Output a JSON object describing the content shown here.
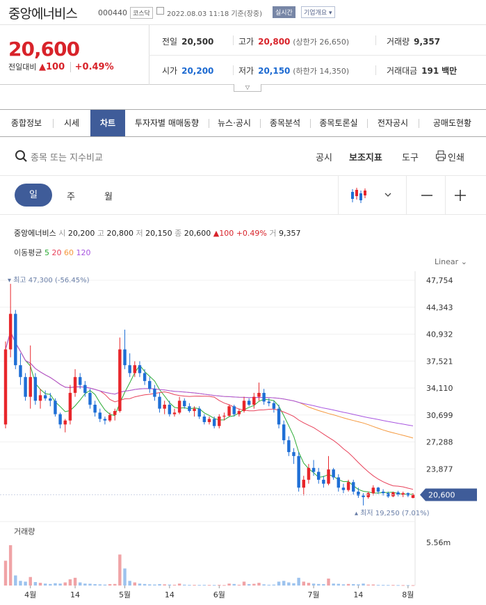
{
  "stock": {
    "name": "중앙에너비스",
    "code": "000440",
    "market": "코스닥",
    "datetime": "2022.08.03 11:18 기준(장중)",
    "realtime": "실시간",
    "company_btn": "기업개요 ▾"
  },
  "summary": {
    "price": "20,600",
    "change_label": "전일대비",
    "change_arrow": "▲",
    "change": "100",
    "change_pct": "+0.49%",
    "prev_label": "전일",
    "prev": "20,500",
    "high_label": "고가",
    "high": "20,800",
    "upper_limit": "(상한가 26,650)",
    "volume_label": "거래량",
    "volume": "9,357",
    "open_label": "시가",
    "open": "20,200",
    "low_label": "저가",
    "low": "20,150",
    "lower_limit": "(하한가 14,350)",
    "amount_label": "거래대금",
    "amount": "191",
    "amount_unit": "백만",
    "fold_icon": "chevron-down-icon"
  },
  "tabs": [
    "종합정보",
    "시세",
    "차트",
    "투자자별 매매동향",
    "뉴스·공시",
    "종목분석",
    "종목토론실",
    "전자공시",
    "공매도현황"
  ],
  "active_tab": "차트",
  "search": {
    "placeholder": "종목 또는 지수비교",
    "disclosure": "공시",
    "indicator": "보조지표",
    "tools": "도구",
    "print": "인쇄"
  },
  "periods": [
    "일",
    "주",
    "월"
  ],
  "active_period": "일",
  "ohlc": {
    "name": "중앙에너비스",
    "o_label": "시",
    "o": "20,200",
    "h_label": "고",
    "h": "20,800",
    "l_label": "저",
    "l": "20,150",
    "c_label": "종",
    "c": "20,600",
    "arrow": "▲",
    "chg": "100",
    "pct": "+0.49%",
    "v_label": "거",
    "v": "9,357"
  },
  "ma": {
    "label": "이동평균",
    "periods": [
      "5",
      "20",
      "60",
      "120"
    ],
    "colors": [
      "#2bab35",
      "#e8415a",
      "#f5983d",
      "#a855e0"
    ]
  },
  "scale": "Linear",
  "colors": {
    "up": "#e8262b",
    "down": "#1f6fd6",
    "accent": "#3f5c99",
    "max_label": "#6a7fa8"
  },
  "chart_data": {
    "type": "candlestick",
    "y_ticks": [
      "47,754",
      "44,343",
      "40,932",
      "37,521",
      "34,110",
      "30,699",
      "27,288",
      "23,877"
    ],
    "ylim": [
      20466,
      47754
    ],
    "x_ticks": [
      "4월",
      "14",
      "5월",
      "14",
      "6월",
      "7월",
      "14",
      "8월"
    ],
    "x_tick_index": [
      5,
      14,
      24,
      33,
      43,
      62,
      71,
      81
    ],
    "last_price_label": "20,600",
    "max_label": "최고 47,300 (-56.45%)",
    "max_index": 1,
    "max_value": 47300,
    "min_label": "최저 19,250 (7.01%)",
    "min_index": 72,
    "min_value": 19250,
    "volume_label": "거래량",
    "volume_tick": "5.56m",
    "volume_max": 5560000,
    "candles": [
      [
        29500,
        40000,
        29000,
        39000,
        3200000
      ],
      [
        39000,
        47300,
        38000,
        43500,
        5200000
      ],
      [
        43500,
        44000,
        36500,
        37000,
        1300000
      ],
      [
        37000,
        38500,
        34500,
        35500,
        600000
      ],
      [
        35500,
        36000,
        32500,
        33000,
        500000
      ],
      [
        33000,
        39500,
        31500,
        35500,
        1100000
      ],
      [
        35500,
        36000,
        32000,
        32500,
        450000
      ],
      [
        32500,
        34000,
        31500,
        33200,
        350000
      ],
      [
        33200,
        33800,
        32500,
        32800,
        250000
      ],
      [
        32800,
        33500,
        31800,
        32500,
        200000
      ],
      [
        32500,
        32800,
        30500,
        30800,
        300000
      ],
      [
        30800,
        31000,
        29000,
        29500,
        250000
      ],
      [
        29500,
        30200,
        28500,
        30000,
        400000
      ],
      [
        30000,
        34500,
        29500,
        33500,
        800000
      ],
      [
        33500,
        36500,
        33000,
        35500,
        1000000
      ],
      [
        35500,
        36000,
        34000,
        34500,
        400000
      ],
      [
        34500,
        35000,
        33000,
        33500,
        250000
      ],
      [
        33500,
        34000,
        31500,
        32000,
        230000
      ],
      [
        32000,
        32500,
        30500,
        31000,
        180000
      ],
      [
        31000,
        31500,
        29800,
        30200,
        150000
      ],
      [
        30200,
        30500,
        29500,
        30000,
        120000
      ],
      [
        30000,
        31000,
        29800,
        30700,
        180000
      ],
      [
        30700,
        31500,
        30000,
        31200,
        200000
      ],
      [
        31200,
        40500,
        31000,
        39000,
        4000000
      ],
      [
        39000,
        41500,
        36500,
        37000,
        2200000
      ],
      [
        37000,
        38500,
        35500,
        36000,
        600000
      ],
      [
        36000,
        37500,
        35500,
        37000,
        400000
      ],
      [
        37000,
        37500,
        35500,
        36000,
        250000
      ],
      [
        36000,
        36500,
        34500,
        35000,
        200000
      ],
      [
        35000,
        35500,
        33500,
        34000,
        150000
      ],
      [
        34000,
        34500,
        32500,
        33000,
        130000
      ],
      [
        33000,
        33500,
        31000,
        31500,
        180000
      ],
      [
        31500,
        32500,
        30800,
        32000,
        150000
      ],
      [
        32000,
        32500,
        30500,
        30800,
        120000
      ],
      [
        30800,
        31500,
        30500,
        31000,
        100000
      ],
      [
        31000,
        33000,
        30800,
        32500,
        250000
      ],
      [
        32500,
        32800,
        31500,
        31800,
        110000
      ],
      [
        31800,
        32200,
        31000,
        31200,
        90000
      ],
      [
        31200,
        31800,
        30500,
        31500,
        85000
      ],
      [
        31500,
        31800,
        30200,
        30500,
        80000
      ],
      [
        30500,
        30800,
        29500,
        29800,
        90000
      ],
      [
        29800,
        30500,
        29500,
        30200,
        75000
      ],
      [
        30200,
        30500,
        29000,
        29300,
        70000
      ],
      [
        29300,
        30800,
        29000,
        30500,
        90000
      ],
      [
        30500,
        31000,
        30000,
        30600,
        60000
      ],
      [
        30600,
        32000,
        30500,
        31800,
        250000
      ],
      [
        31800,
        32000,
        30500,
        30800,
        200000
      ],
      [
        30800,
        31500,
        30500,
        31200,
        100000
      ],
      [
        31200,
        33000,
        31000,
        32500,
        500000
      ],
      [
        32500,
        32800,
        31800,
        32000,
        180000
      ],
      [
        32000,
        33500,
        31500,
        33000,
        220000
      ],
      [
        33000,
        34800,
        32500,
        33500,
        350000
      ],
      [
        33500,
        34000,
        32000,
        32400,
        150000
      ],
      [
        32400,
        32800,
        31800,
        32200,
        100000
      ],
      [
        32200,
        32500,
        31000,
        31500,
        120000
      ],
      [
        31500,
        32000,
        29000,
        29500,
        500000
      ],
      [
        29500,
        30000,
        27000,
        27500,
        600000
      ],
      [
        27500,
        28000,
        25500,
        26000,
        400000
      ],
      [
        26000,
        26500,
        24500,
        25500,
        300000
      ],
      [
        25500,
        26000,
        21000,
        21500,
        1000000
      ],
      [
        21500,
        23000,
        20500,
        22500,
        500000
      ],
      [
        22500,
        24500,
        22000,
        24000,
        350000
      ],
      [
        24000,
        25000,
        23000,
        23500,
        250000
      ],
      [
        23500,
        24000,
        22000,
        22500,
        200000
      ],
      [
        22500,
        23000,
        21500,
        22000,
        180000
      ],
      [
        22000,
        25500,
        21800,
        23800,
        900000
      ],
      [
        23800,
        24000,
        22500,
        22800,
        250000
      ],
      [
        22800,
        23200,
        21000,
        21500,
        220000
      ],
      [
        21500,
        22000,
        20800,
        21200,
        150000
      ],
      [
        21200,
        22500,
        21000,
        22200,
        200000
      ],
      [
        22200,
        22500,
        20600,
        21000,
        180000
      ],
      [
        21000,
        21500,
        20200,
        20500,
        150000
      ],
      [
        20500,
        20800,
        19250,
        20300,
        250000
      ],
      [
        20300,
        21000,
        20100,
        20800,
        120000
      ],
      [
        20800,
        21800,
        20500,
        21500,
        130000
      ],
      [
        21500,
        21600,
        20700,
        21000,
        90000
      ],
      [
        21000,
        21300,
        20500,
        20800,
        80000
      ],
      [
        20800,
        21000,
        20200,
        20400,
        70000
      ],
      [
        20400,
        21000,
        20300,
        20900,
        75000
      ],
      [
        20900,
        21100,
        20400,
        20600,
        60000
      ],
      [
        20600,
        21000,
        20300,
        20800,
        55000
      ],
      [
        20800,
        20900,
        20300,
        20500,
        50000
      ],
      [
        20200,
        20800,
        20150,
        20600,
        45000
      ]
    ]
  }
}
